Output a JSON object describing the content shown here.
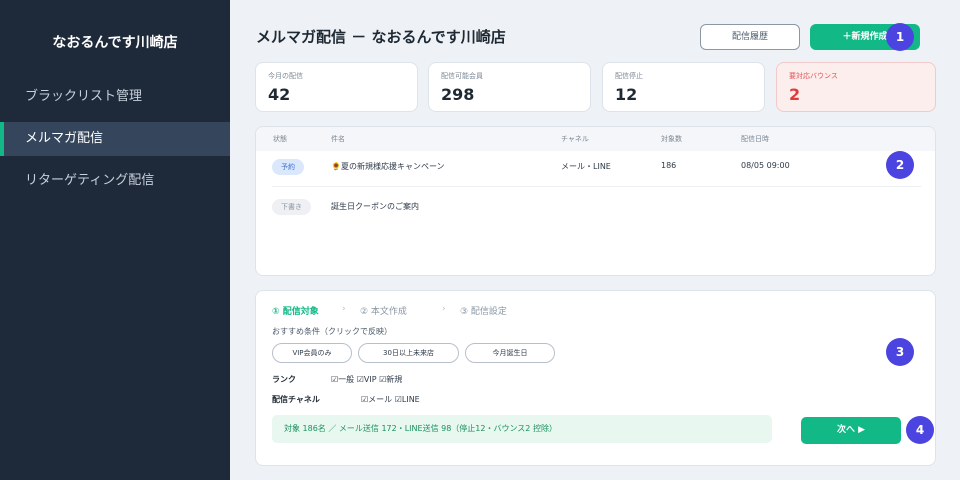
{
  "sidebar": {
    "store_name": "なおるんです川崎店",
    "items": [
      {
        "label": "ブラックリスト管理",
        "active": false
      },
      {
        "label": "メルマガ配信",
        "active": true
      },
      {
        "label": "リターゲティング配信",
        "active": false
      }
    ]
  },
  "header": {
    "title": "メルマガ配信 － なおるんです川崎店",
    "history_button": "配信履歴",
    "new_button": "＋新規作成"
  },
  "badges": [
    "1",
    "2",
    "3",
    "4"
  ],
  "stats": [
    {
      "label": "今月の配信",
      "value": "42"
    },
    {
      "label": "配信可能会員",
      "value": "298"
    },
    {
      "label": "配信停止",
      "value": "12"
    },
    {
      "label": "要対応バウンス",
      "value": "2",
      "alert": true
    }
  ],
  "table": {
    "columns": [
      "状態",
      "件名",
      "チャネル",
      "対象数",
      "配信日時"
    ],
    "rows": [
      {
        "status": "予約",
        "subject": "🌻夏の新規様応援キャンペーン",
        "channel": "メール・LINE",
        "count": "186",
        "datetime": "08/05 09:00"
      },
      {
        "status": "下書き",
        "subject": "誕生日クーポンのご案内",
        "channel": "",
        "count": "",
        "datetime": ""
      }
    ]
  },
  "wizard": {
    "steps": [
      "① 配信対象",
      "② 本文作成",
      "③ 配信設定"
    ],
    "step_separator": "›",
    "hint": "おすすめ条件（クリックで反映）",
    "chips": [
      "VIP会員のみ",
      "30日以上未来店",
      "今月誕生日"
    ],
    "rank_label": "ランク",
    "rank_options": "☑一般 ☑VIP ☑新規",
    "channel_label": "配信チャネル",
    "channel_options": "☑メール ☑LINE",
    "summary": "対象 186名 ／ メール送信 172・LINE送信 98（停止12・バウンス2 控除）",
    "next_button": "次へ ▶"
  },
  "colors": {
    "sidebar_bg": "#1e2a3a",
    "accent_green": "#12b886",
    "badge_purple": "#4c44e0",
    "alert_red": "#e03b3b"
  }
}
